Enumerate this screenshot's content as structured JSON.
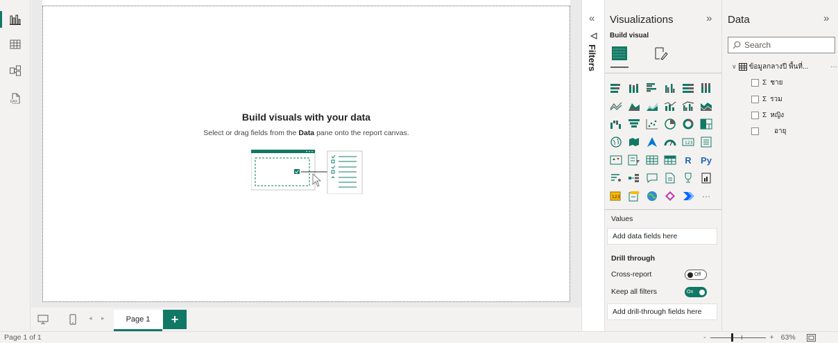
{
  "rail": {
    "items": [
      {
        "name": "report-view",
        "active": true
      },
      {
        "name": "table-view",
        "active": false
      },
      {
        "name": "model-view",
        "active": false
      },
      {
        "name": "dax-query-view",
        "active": false
      }
    ],
    "dax_label": "DAX"
  },
  "canvas": {
    "empty_title": "Build visuals with your data",
    "empty_sub_prefix": "Select or drag fields from the ",
    "empty_sub_bold": "Data",
    "empty_sub_suffix": " pane onto the report canvas."
  },
  "tabs": {
    "pages": [
      "Page 1"
    ],
    "add_label": "+"
  },
  "status": {
    "page_info": "Page 1 of 1",
    "zoom_minus": "-",
    "zoom_plus": "+",
    "zoom_level": "63%"
  },
  "filters": {
    "label": "Filters",
    "collapse_glyph": "«"
  },
  "visualizations": {
    "title": "Visualizations",
    "expand_glyph": "»",
    "build_visual_label": "Build visual",
    "values_label": "Values",
    "values_placeholder": "Add data fields here",
    "drill_through_label": "Drill through",
    "cross_report_label": "Cross-report",
    "cross_report_state": "Off",
    "keep_filters_label": "Keep all filters",
    "keep_filters_state": "On",
    "drill_placeholder": "Add drill-through fields here",
    "more_glyph": "···",
    "r_label": "R",
    "py_label": "Py",
    "accent": "#117865"
  },
  "data_pane": {
    "title": "Data",
    "expand_glyph": "»",
    "search_placeholder": "Search",
    "table_name": "ข้อมูลกลางปี พื้นที่...",
    "table_more": "···",
    "fields": [
      {
        "name": "ชาย",
        "sigma": true
      },
      {
        "name": "รวม",
        "sigma": true
      },
      {
        "name": "หญิง",
        "sigma": true
      },
      {
        "name": "อายุ",
        "sigma": false
      }
    ],
    "sigma_glyph": "Σ"
  }
}
